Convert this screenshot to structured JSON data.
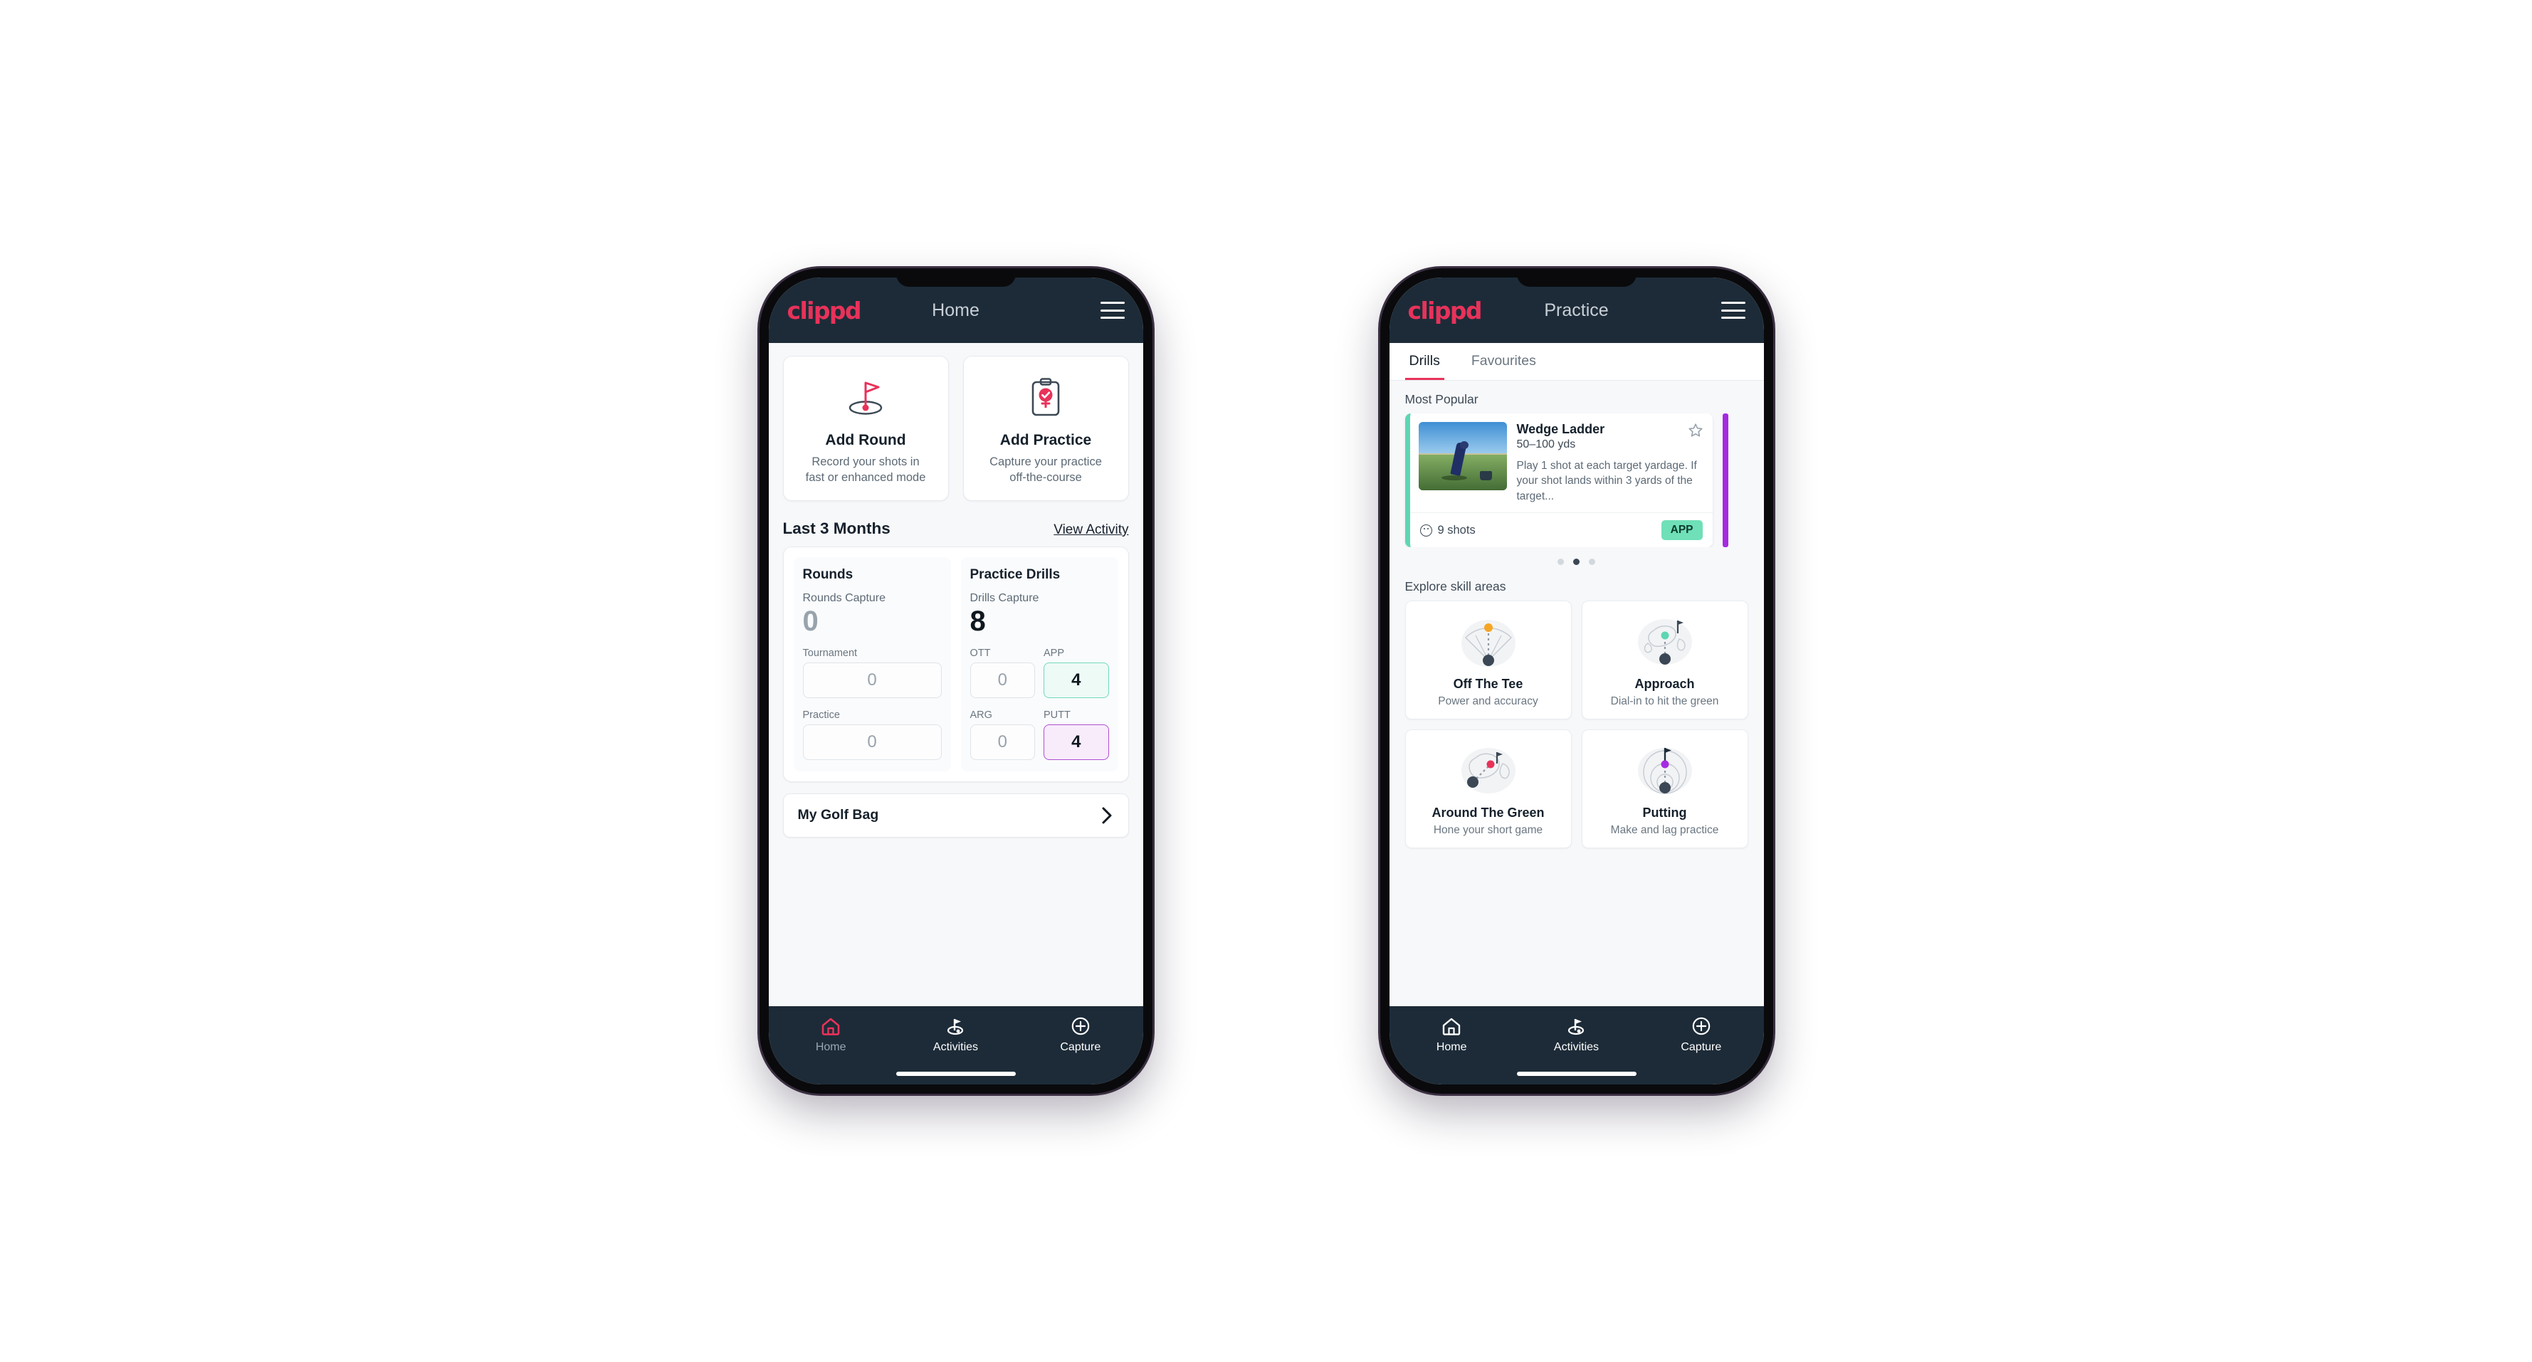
{
  "brand": {
    "logo_text": "clippd",
    "accent": "#e8325a",
    "header_bg": "#1d2b38"
  },
  "phone_home": {
    "header": {
      "title": "Home",
      "menu_icon": "hamburger-icon"
    },
    "actions": [
      {
        "icon": "golf-flag-hole-icon",
        "title": "Add Round",
        "desc_line1": "Record your shots in",
        "desc_line2": "fast or enhanced mode"
      },
      {
        "icon": "clipboard-check-icon",
        "title": "Add Practice",
        "desc_line1": "Capture your practice",
        "desc_line2": "off-the-course"
      }
    ],
    "section": {
      "title": "Last 3 Months",
      "link": "View Activity"
    },
    "stats": {
      "rounds": {
        "title": "Rounds",
        "capture_label": "Rounds Capture",
        "capture_value": "0",
        "fields": [
          {
            "label": "Tournament",
            "value": "0",
            "accent": "none"
          },
          {
            "label": "Practice",
            "value": "0",
            "accent": "none"
          }
        ]
      },
      "drills": {
        "title": "Practice Drills",
        "capture_label": "Drills Capture",
        "capture_value": "8",
        "fields": [
          {
            "label": "OTT",
            "value": "0",
            "accent": "none"
          },
          {
            "label": "APP",
            "value": "4",
            "accent": "green"
          },
          {
            "label": "ARG",
            "value": "0",
            "accent": "none"
          },
          {
            "label": "PUTT",
            "value": "4",
            "accent": "purple"
          }
        ]
      }
    },
    "golf_bag": {
      "label": "My Golf Bag",
      "chevron_icon": "chevron-right-icon"
    },
    "bottom_nav": [
      {
        "icon": "home-icon",
        "label": "Home",
        "state": "active"
      },
      {
        "icon": "golf-flag-icon",
        "label": "Activities",
        "state": "inactive"
      },
      {
        "icon": "plus-circle-icon",
        "label": "Capture",
        "state": "inactive"
      }
    ]
  },
  "phone_practice": {
    "header": {
      "title": "Practice",
      "menu_icon": "hamburger-icon"
    },
    "tabs": [
      {
        "label": "Drills",
        "active": true
      },
      {
        "label": "Favourites",
        "active": false
      }
    ],
    "most_popular": {
      "label": "Most Popular"
    },
    "drill": {
      "title": "Wedge Ladder",
      "yardage": "50–100 yds",
      "description": "Play 1 shot at each target yardage. If your shot lands within 3 yards of the target...",
      "shots": "9 shots",
      "shots_icon": "golf-ball-icon",
      "badge": "APP",
      "badge_color": "#6fe0b8",
      "favourite_icon": "star-outline-icon",
      "accent_left": "#5ed6b2",
      "accent_next": "#a52be0",
      "thumbnail": "golfer-practicing-photo"
    },
    "carousel_dots": {
      "count": 3,
      "active_index": 1
    },
    "explore": {
      "label": "Explore skill areas"
    },
    "skills": [
      {
        "icon": "tee-dispersion-icon",
        "name": "Off The Tee",
        "desc": "Power and accuracy",
        "dot_color": "#f5a623"
      },
      {
        "icon": "green-approach-icon",
        "name": "Approach",
        "desc": "Dial-in to hit the green",
        "dot_color": "#5ed6b2"
      },
      {
        "icon": "chip-around-green-icon",
        "name": "Around The Green",
        "desc": "Hone your short game",
        "dot_color": "#e8325a"
      },
      {
        "icon": "putting-rings-icon",
        "name": "Putting",
        "desc": "Make and lag practice",
        "dot_color": "#a52be0"
      }
    ],
    "bottom_nav": [
      {
        "icon": "home-icon",
        "label": "Home",
        "state": "inactive"
      },
      {
        "icon": "golf-flag-icon",
        "label": "Activities",
        "state": "inactive"
      },
      {
        "icon": "plus-circle-icon",
        "label": "Capture",
        "state": "inactive"
      }
    ]
  }
}
